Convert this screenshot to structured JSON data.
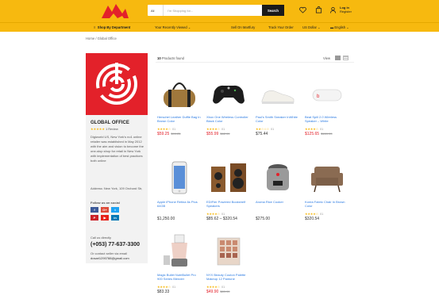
{
  "header": {
    "search_category": "All",
    "search_placeholder": "I'm Shopping for...",
    "search_button": "Search",
    "account_line1": "Log in",
    "account_line2": "Register"
  },
  "nav": {
    "department": "Shop By Department",
    "recent": "Your Recently Viewed",
    "sell": "Sell On Martfury",
    "track": "Track Your Order",
    "currency": "US Dollar",
    "language": "English"
  },
  "breadcrumb": "Home / Global Office",
  "store": {
    "name": "GLOBAL OFFICE",
    "rating_stars": "★★★★★",
    "rating_text": "1 Review",
    "description": "Digiworld US, New York's no1 online retailer was established in May 2012 with the aim and vision to become the one-stop shop for retail in New York with implementation of best practices both online",
    "address": "Address: New York, 109 Orchard Str,",
    "follow_label": "Follow us on social",
    "social": [
      "f",
      "G+",
      "t",
      "P",
      "▶",
      "in"
    ],
    "contact_label": "Call us directly",
    "phone": "(+053) 77-637-3300",
    "or_label": "Or contact seller via email",
    "email": "dosari1290788@gmail.com"
  },
  "toolbar": {
    "count": "10",
    "found_text": "Products found",
    "view_label": "View"
  },
  "products": [
    {
      "name": "Herschel Leather Duffle Bag In Brown Color",
      "stars": "★★★★☆",
      "count": "01",
      "price": "$59.25",
      "old": "$99.25",
      "sale": true
    },
    {
      "name": "Xbox One Wireless Controller Black Color",
      "stars": "★★★★☆",
      "count": "01",
      "price": "$55.99",
      "old": "$62.99",
      "sale": true
    },
    {
      "name": "Paul's Smith Sneaker InWhite Color",
      "stars": "★★☆☆☆",
      "count": "01",
      "price": "$75.44",
      "old": "",
      "sale": false
    },
    {
      "name": "Beat Spill 2.0 Wireless Speaker – White",
      "stars": "★★★★☆",
      "count": "01",
      "price": "$125.65",
      "old": "$169.99",
      "sale": true
    },
    {
      "name": "Apple iPhone Retina 6s Plus 64GB",
      "stars": "",
      "count": "",
      "price": "$1,250.00",
      "old": "",
      "sale": false
    },
    {
      "name": "EDIFier Powered Bookshelf Speakers",
      "stars": "★★★★☆",
      "count": "01",
      "price": "$85.62 – $320.54",
      "old": "",
      "sale": false
    },
    {
      "name": "Aroma Rice Cooker",
      "stars": "",
      "count": "",
      "price": "$275.00",
      "old": "",
      "sale": false
    },
    {
      "name": "Korea Fabric Chair In Brown Color",
      "stars": "★★★★☆",
      "count": "01",
      "price": "$320.54",
      "old": "",
      "sale": false
    },
    {
      "name": "Magic Bullet NutriBullet Pro 900 Series Blender",
      "stars": "★★★★☆",
      "count": "01",
      "price": "$83.33",
      "old": "",
      "sale": false
    },
    {
      "name": "NYX Beauty Couton Palette Makeup 12 Pantone",
      "stars": "★★★★☆",
      "count": "01",
      "price": "$49.90",
      "old": "$89.99",
      "sale": true
    }
  ],
  "colors": {
    "brand": "#f7b90f",
    "accent": "#e3212a",
    "link": "#2a7ae2"
  }
}
